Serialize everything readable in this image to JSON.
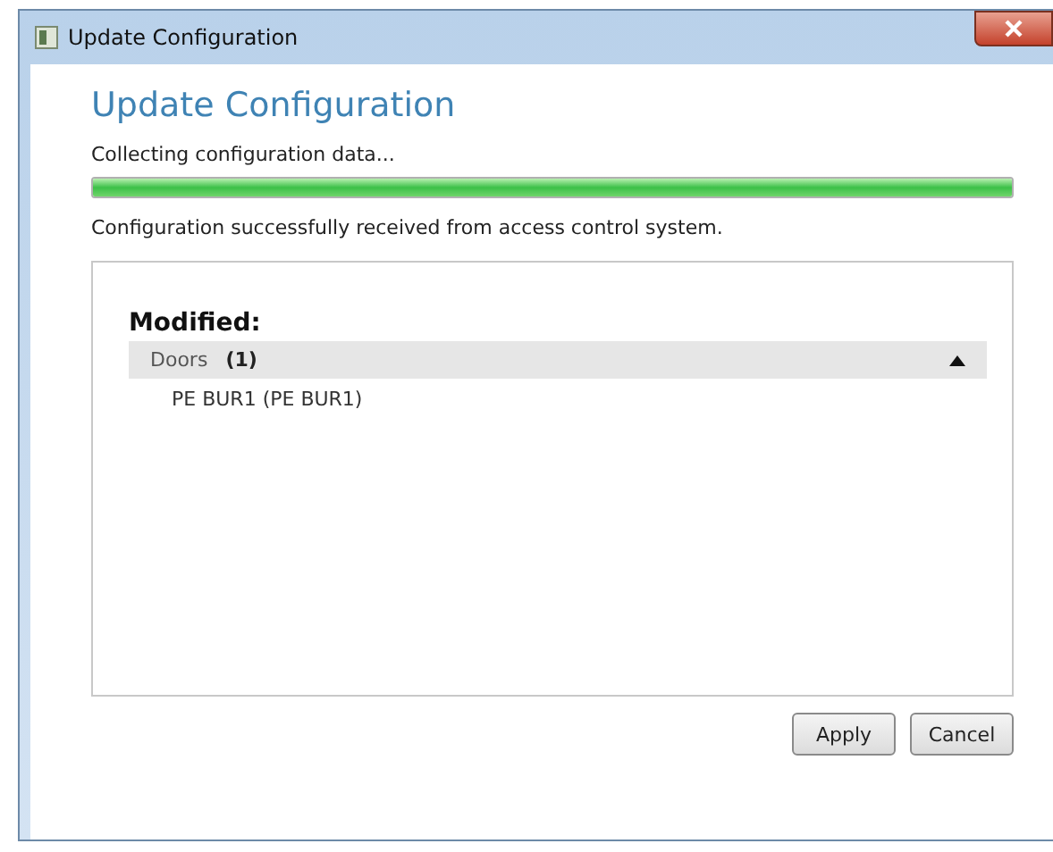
{
  "window": {
    "title": "Update Configuration"
  },
  "heading": "Update Configuration",
  "status": "Collecting configuration data...",
  "progress": {
    "level": 1
  },
  "message": "Configuration successfully received from access control system.",
  "changes": {
    "title": "Modified:",
    "groups": [
      {
        "name": "Doors",
        "count": "(1)",
        "expanded": true,
        "items": [
          "PE BUR1 (PE BUR1)"
        ]
      }
    ]
  },
  "buttons": [
    "Apply",
    "Cancel"
  ]
}
